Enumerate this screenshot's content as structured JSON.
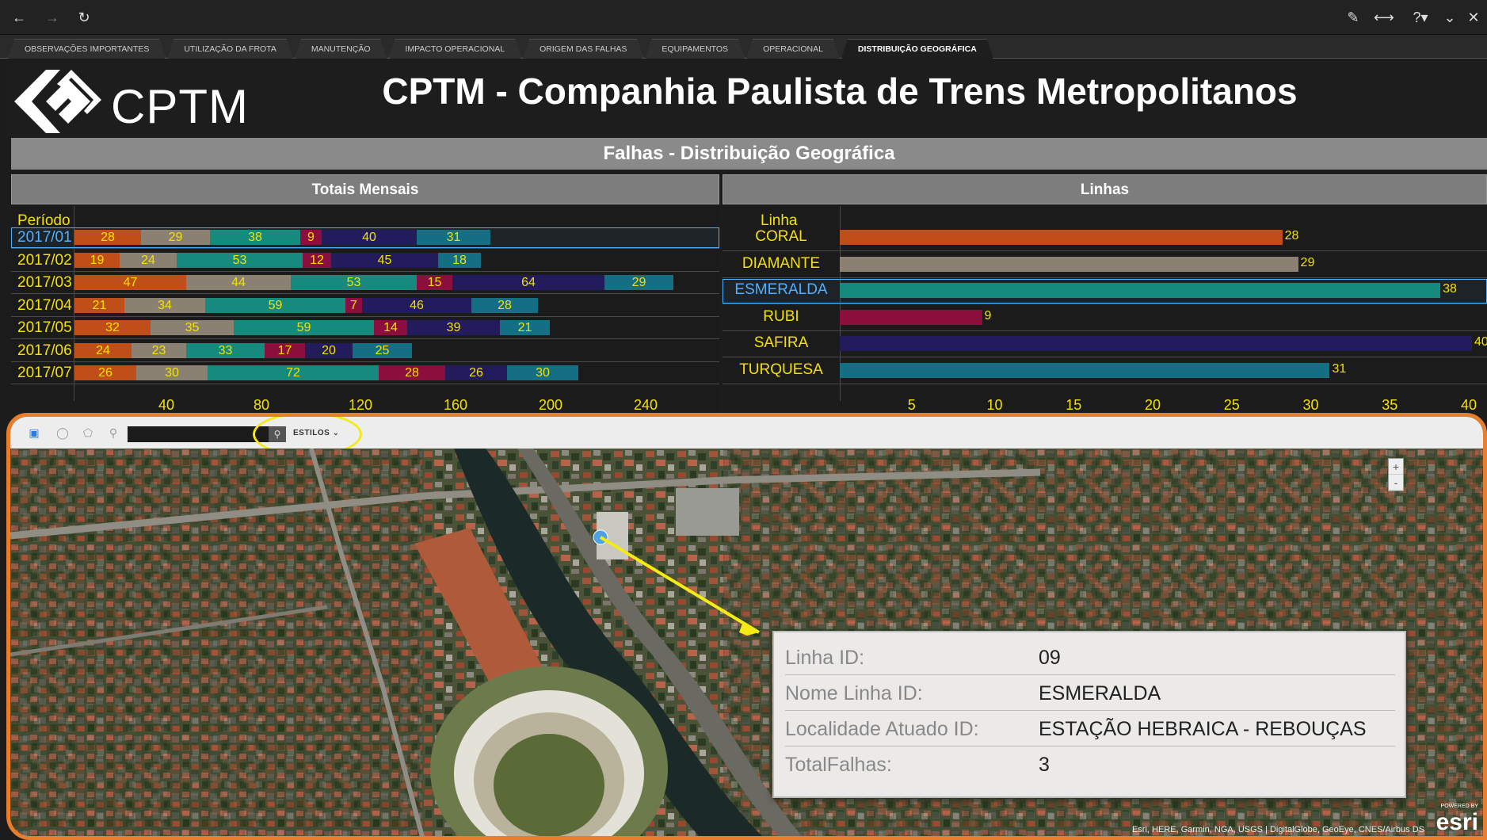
{
  "tabs": [
    {
      "label": "OBSERVAÇÕES IMPORTANTES"
    },
    {
      "label": "UTILIZAÇÃO DA FROTA"
    },
    {
      "label": "MANUTENÇÃO"
    },
    {
      "label": "IMPACTO OPERACIONAL"
    },
    {
      "label": "ORIGEM DAS FALHAS"
    },
    {
      "label": "EQUIPAMENTOS"
    },
    {
      "label": "OPERACIONAL"
    },
    {
      "label": "DISTRIBUIÇÃO GEOGRÁFICA"
    }
  ],
  "header": {
    "logo_text": "CPTM",
    "title": "CPTM - Companhia Paulista de Trens Metropolitanos"
  },
  "section": {
    "title": "Falhas - Distribuição Geográfica"
  },
  "colors": {
    "coral": "#c04e19",
    "diamante": "#8b8172",
    "esmeralda": "#178a7e",
    "rubi": "#8a0f3d",
    "safira": "#231c5c",
    "turquesa": "#146f85",
    "label": "#f3e200",
    "selected": "#4fb0ff"
  },
  "chart_data": [
    {
      "type": "bar",
      "orientation": "horizontal",
      "stacked": true,
      "title": "Totais Mensais",
      "ytitle": "Período",
      "categories": [
        "2017/01",
        "2017/02",
        "2017/03",
        "2017/04",
        "2017/05",
        "2017/06",
        "2017/07"
      ],
      "selected": "2017/01",
      "series": [
        {
          "key": "coral",
          "values": [
            28,
            19,
            47,
            21,
            32,
            24,
            26
          ]
        },
        {
          "key": "diamante",
          "values": [
            29,
            24,
            44,
            34,
            35,
            23,
            30
          ]
        },
        {
          "key": "esmeralda",
          "values": [
            38,
            53,
            53,
            59,
            59,
            33,
            72
          ]
        },
        {
          "key": "rubi",
          "values": [
            9,
            12,
            15,
            7,
            14,
            17,
            28
          ]
        },
        {
          "key": "safira",
          "values": [
            40,
            45,
            64,
            46,
            39,
            20,
            26
          ]
        },
        {
          "key": "turquesa",
          "values": [
            31,
            18,
            29,
            28,
            21,
            25,
            30
          ]
        }
      ],
      "xticks": [
        40,
        80,
        120,
        160,
        200,
        240
      ],
      "xlim": [
        0,
        260
      ]
    },
    {
      "type": "bar",
      "orientation": "horizontal",
      "title": "Linhas",
      "ytitle": "Linha",
      "categories": [
        "CORAL",
        "DIAMANTE",
        "ESMERALDA",
        "RUBI",
        "SAFIRA",
        "TURQUESA"
      ],
      "keys": [
        "coral",
        "diamante",
        "esmeralda",
        "rubi",
        "safira",
        "turquesa"
      ],
      "selected": "ESMERALDA",
      "values": [
        28,
        29,
        38,
        9,
        40,
        31
      ],
      "xticks": [
        5,
        10,
        15,
        20,
        25,
        30,
        35,
        40
      ],
      "xlim": [
        0,
        40
      ]
    }
  ],
  "map": {
    "styles_label": "ESTILOS",
    "zoom_in": "+",
    "zoom_out": "-",
    "attribution": "Esri, HERE, Garmin, NGA, USGS | DigitalGlobe, GeoEye, CNES/Airbus DS",
    "esri_label": "esri",
    "powered_label": "POWERED BY",
    "popup": [
      {
        "key": "Linha ID:",
        "value": "09"
      },
      {
        "key": "Nome Linha ID:",
        "value": "ESMERALDA"
      },
      {
        "key": "Localidade Atuado ID:",
        "value": "ESTAÇÃO HEBRAICA - REBOUÇAS"
      },
      {
        "key": "TotalFalhas:",
        "value": "3"
      }
    ]
  },
  "icons": {
    "back": "back-arrow-icon",
    "forward": "forward-arrow-icon",
    "refresh": "refresh-icon",
    "edit": "pencil-icon",
    "share": "share-icon",
    "help": "help-icon",
    "collapse": "chevron-down-icon",
    "close": "close-icon"
  }
}
